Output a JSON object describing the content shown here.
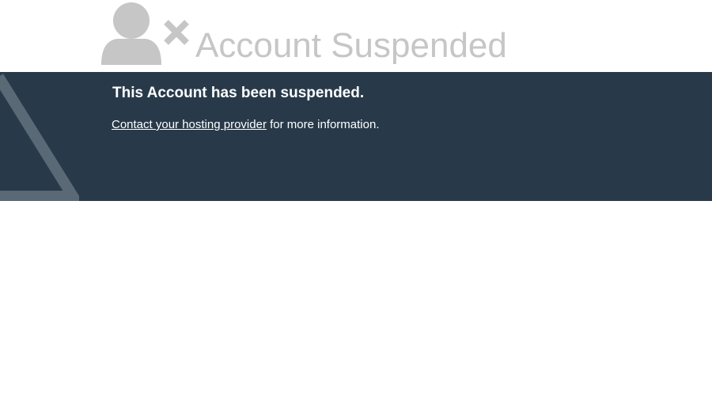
{
  "header": {
    "icon": "user-x-icon",
    "title": "Account Suspended"
  },
  "banner": {
    "decoration_icon": "warning-triangle-icon",
    "heading": "This Account has been suspended.",
    "link_text": "Contact your hosting provider",
    "trailing_text": " for more information."
  },
  "colors": {
    "banner_background": "#283a4a",
    "title_gray": "#c6c6c6",
    "icon_gray": "#c6c6c6",
    "triangle_gray": "#5a6976"
  }
}
